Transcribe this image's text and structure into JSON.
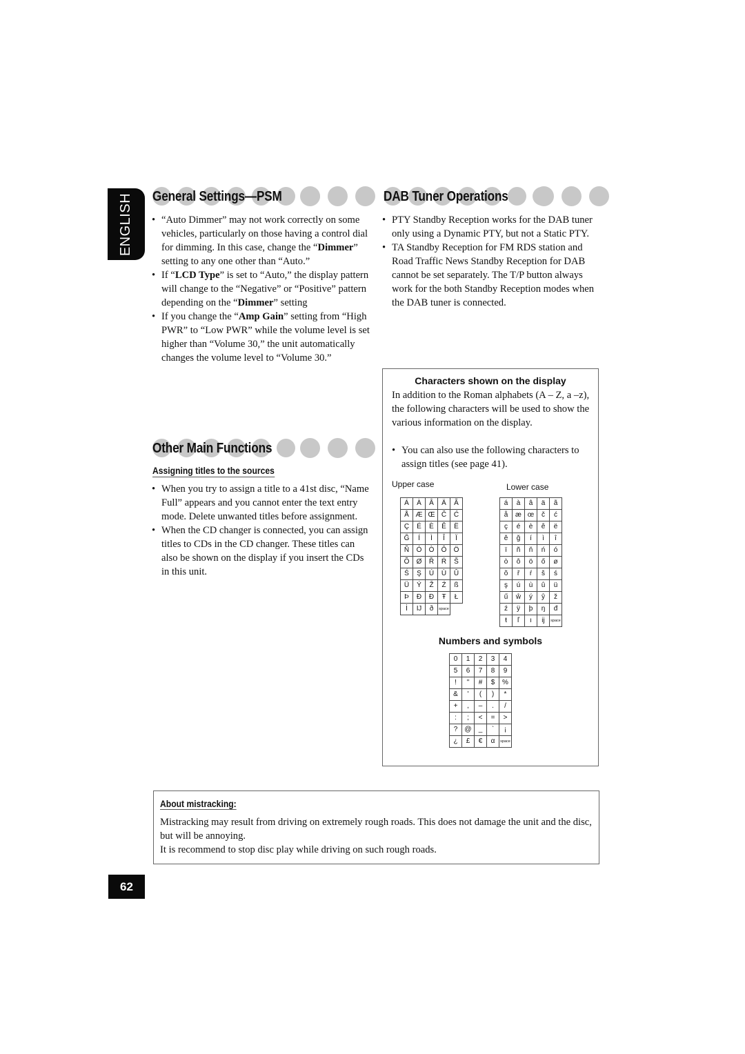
{
  "language_tab": "ENGLISH",
  "page_number": "62",
  "general_settings": {
    "title": "General Settings—PSM",
    "bullets": [
      {
        "pre": "“Auto Dimmer” may not work correctly on some vehicles, particularly on those having a control dial for dimming. In this case, change the “",
        "bold": "Dimmer",
        "post": "” setting to any one other than “Auto.”"
      },
      {
        "pre": " If “",
        "bold": "LCD Type",
        "post": "” is set to “Auto,” the display pattern will change to the “Negative” or “Positive” pattern depending on the “",
        "bold2": "Dimmer",
        "post2": "” setting"
      },
      {
        "pre": "If you change the “",
        "bold": "Amp Gain",
        "post": "” setting from “High PWR” to “Low PWR” while the volume level is set higher than “Volume 30,” the unit automatically changes the volume level to “Volume 30.”"
      }
    ]
  },
  "other_functions": {
    "title": "Other Main Functions",
    "subheading": "Assigning titles to the sources",
    "bullets": [
      "When you try to assign a title to a 41st disc, “Name Full” appears and you cannot enter the text entry mode. Delete unwanted titles before assignment.",
      "When the CD changer is connected, you can assign titles to CDs in the CD changer. These titles can also be shown on the display if you insert the CDs in this unit."
    ]
  },
  "dab": {
    "title": "DAB Tuner Operations",
    "bullets": [
      "PTY Standby Reception works for the DAB tuner only using a Dynamic PTY, but not a Static PTY.",
      "TA Standby Reception for FM RDS station and Road Traffic News Standby Reception for DAB cannot be set separately. The T/P button always work for the both Standby Reception modes when the DAB tuner is connected."
    ]
  },
  "characters": {
    "heading": "Characters shown on the display",
    "intro": "In addition to the Roman alphabets (A – Z, a –z), the following characters will be used to show the various information on the display.",
    "note": "You can also use the following characters to assign titles (see page 41).",
    "upper_label": "Upper case",
    "lower_label": "Lower case",
    "upper": [
      [
        "Á",
        "À",
        "Â",
        "Ä",
        "Ã"
      ],
      [
        "Å",
        "Æ",
        "Œ",
        "Č",
        "Ć"
      ],
      [
        "Ç",
        "É",
        "È",
        "Ê",
        "Ë"
      ],
      [
        "Ğ",
        "Í",
        "Ì",
        "Î",
        "Ï"
      ],
      [
        "Ñ",
        "Ó",
        "Ò",
        "Ô",
        "Ö"
      ],
      [
        "Õ",
        "Ø",
        "Ř",
        "Ŕ",
        "Š"
      ],
      [
        "Ś",
        "Ş",
        "Ú",
        "Ù",
        "Û"
      ],
      [
        "Ü",
        "Ý",
        "Ž",
        "Ź",
        "ß"
      ],
      [
        "Þ",
        "Ð",
        "Đ",
        "Ŧ",
        "Ł"
      ],
      [
        "İ",
        "Ĳ",
        "ð",
        "space",
        ""
      ]
    ],
    "lower": [
      [
        "á",
        "à",
        "â",
        "ä",
        "ã"
      ],
      [
        "å",
        "æ",
        "œ",
        "č",
        "ć"
      ],
      [
        "ç",
        "é",
        "è",
        "ê",
        "ë"
      ],
      [
        "ě",
        "ğ",
        "í",
        "ì",
        "î"
      ],
      [
        "ï",
        "ñ",
        "ň",
        "ń",
        "ó"
      ],
      [
        "ò",
        "ô",
        "ö",
        "ő",
        "ø"
      ],
      [
        "õ",
        "ř",
        "ŕ",
        "š",
        "ś"
      ],
      [
        "ş",
        "ú",
        "ù",
        "û",
        "ü"
      ],
      [
        "ű",
        "ŵ",
        "ý",
        "ŷ",
        "ž"
      ],
      [
        "ź",
        "ÿ",
        "þ",
        "ŋ",
        "đ"
      ],
      [
        "ŧ",
        "ľ",
        "ı",
        "ĳ",
        "space"
      ]
    ]
  },
  "numbers": {
    "heading": "Numbers and symbols",
    "rows": [
      [
        "0",
        "1",
        "2",
        "3",
        "4"
      ],
      [
        "5",
        "6",
        "7",
        "8",
        "9"
      ],
      [
        "!",
        "\"",
        "#",
        "$",
        "%"
      ],
      [
        "&",
        "'",
        "(",
        ")",
        "*"
      ],
      [
        "+",
        ",",
        "–",
        ".",
        "/"
      ],
      [
        ":",
        ";",
        "<",
        "=",
        ">"
      ],
      [
        "?",
        "@",
        "_",
        "`",
        "¡"
      ],
      [
        "¿",
        "£",
        "€",
        "α",
        "space"
      ]
    ]
  },
  "mistracking": {
    "heading": "About mistracking:",
    "lines": [
      "Mistracking may result from driving on extremely rough roads. This does not damage the unit and the disc, but will be annoying.",
      "It is recommend to stop disc play while driving on such rough roads."
    ]
  }
}
